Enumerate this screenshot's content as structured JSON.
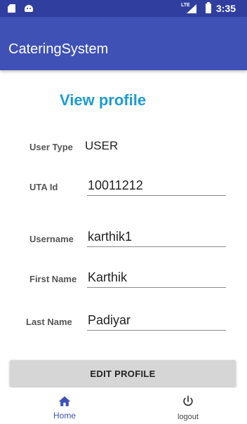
{
  "status_bar": {
    "network": "LTE",
    "time": "3:35"
  },
  "app_bar": {
    "title": "CateringSystem"
  },
  "page": {
    "title": "View profile"
  },
  "profile": {
    "user_type": {
      "label": "User Type",
      "value": "USER"
    },
    "uta_id": {
      "label": "UTA Id",
      "value": "10011212"
    },
    "username": {
      "label": "Username",
      "value": "karthik1"
    },
    "first_name": {
      "label": "First Name",
      "value": "Karthik"
    },
    "last_name": {
      "label": "Last Name",
      "value": "Padiyar"
    }
  },
  "actions": {
    "edit_label": "EDIT PROFILE"
  },
  "bottom_nav": {
    "items": [
      {
        "label": "Home",
        "icon": "home-icon",
        "selected": true
      },
      {
        "label": "logout",
        "icon": "power-icon",
        "selected": false
      }
    ]
  },
  "colors": {
    "primary": "#3f51b5",
    "primary_dark": "#303f9f",
    "title_accent": "#1e9bcf"
  }
}
